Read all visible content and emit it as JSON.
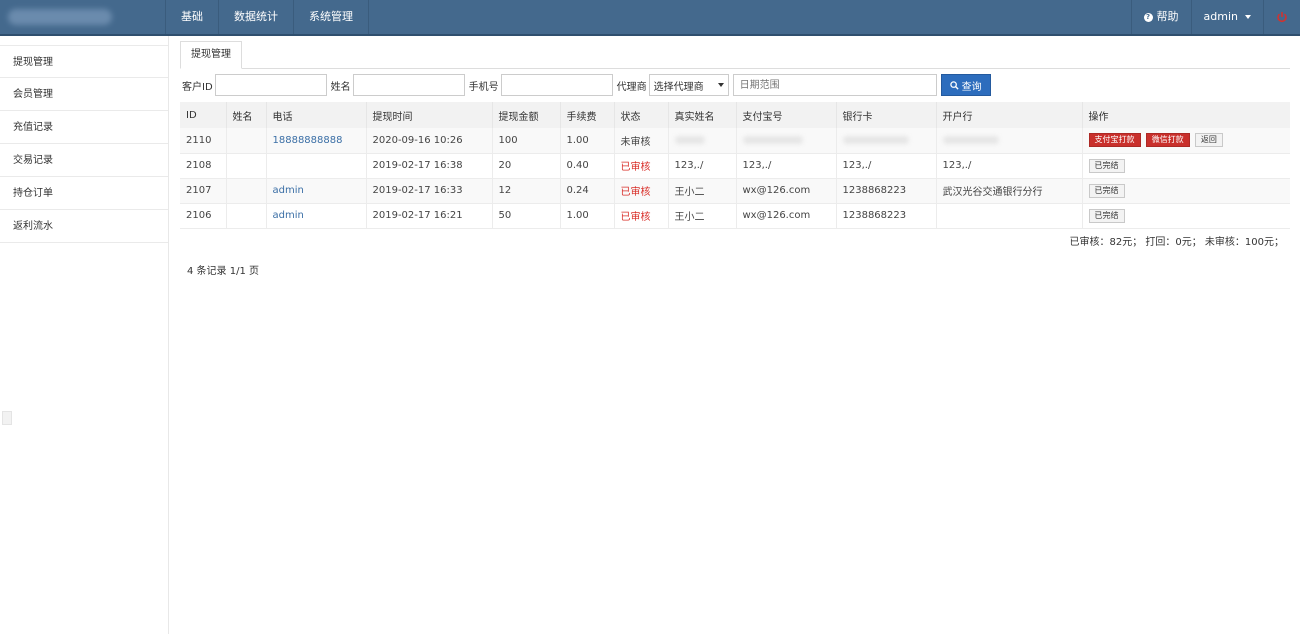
{
  "topnav": [
    "基础",
    "数据统计",
    "系统管理"
  ],
  "topright": {
    "help": "帮助",
    "user": "admin"
  },
  "sidebar": [
    "提现管理",
    "会员管理",
    "充值记录",
    "交易记录",
    "持仓订单",
    "返利流水"
  ],
  "tab": "提现管理",
  "filters": {
    "customer_id_label": "客户ID",
    "name_label": "姓名",
    "phone_label": "手机号",
    "agent_label": "代理商",
    "agent_select": "选择代理商",
    "date_placeholder": "日期范围",
    "search_label": "查询"
  },
  "table": {
    "columns": [
      "ID",
      "姓名",
      "电话",
      "提现时间",
      "提现金额",
      "手续费",
      "状态",
      "真实姓名",
      "支付宝号",
      "银行卡",
      "开户行",
      "操作"
    ],
    "rows": [
      {
        "id": "2110",
        "name": "",
        "phone": "18888888888",
        "time": "2020-09-16 10:26",
        "amount": "100",
        "fee": "1.00",
        "status": "未审核",
        "real_name": "",
        "alipay": "",
        "bank_card": "",
        "bank": "",
        "actions": [
          "支付宝打款",
          "微信打款",
          "返回"
        ]
      },
      {
        "id": "2108",
        "name": "",
        "phone": "",
        "time": "2019-02-17 16:38",
        "amount": "20",
        "fee": "0.40",
        "status": "已审核",
        "real_name": "123,./",
        "alipay": "123,./",
        "bank_card": "123,./",
        "bank": "123,./",
        "actions": [
          "已完结"
        ]
      },
      {
        "id": "2107",
        "name": "",
        "phone": "admin",
        "time": "2019-02-17 16:33",
        "amount": "12",
        "fee": "0.24",
        "status": "已审核",
        "real_name": "王小二",
        "alipay": "wx@126.com",
        "bank_card": "1238868223",
        "bank": "武汉光谷交通银行分行",
        "actions": [
          "已完结"
        ]
      },
      {
        "id": "2106",
        "name": "",
        "phone": "admin",
        "time": "2019-02-17 16:21",
        "amount": "50",
        "fee": "1.00",
        "status": "已审核",
        "real_name": "王小二",
        "alipay": "wx@126.com",
        "bank_card": "1238868223",
        "bank": "",
        "actions": [
          "已完结"
        ]
      }
    ]
  },
  "summary": "已审核：82元； 打回：0元； 未审核：100元；",
  "pager": "4 条记录 1/1 页",
  "colors": {
    "topbar": "#44698d",
    "primary": "#2d6dbd",
    "danger": "#c9302c",
    "status_reviewed": "#d9302a"
  }
}
